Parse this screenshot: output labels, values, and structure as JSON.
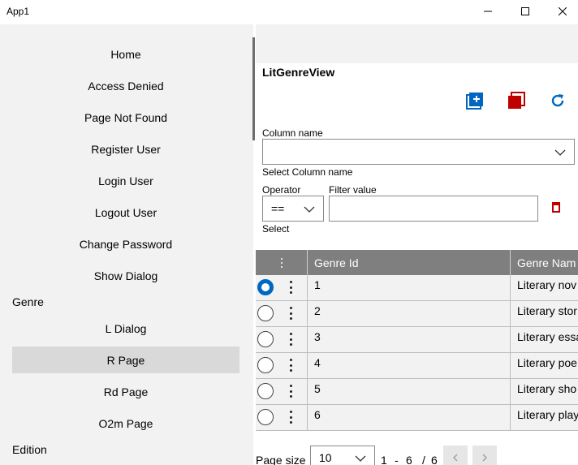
{
  "window": {
    "title": "App1"
  },
  "nav": {
    "items": [
      {
        "label": "Home"
      },
      {
        "label": "Access Denied"
      },
      {
        "label": "Page Not Found"
      },
      {
        "label": "Register User"
      },
      {
        "label": "Login User"
      },
      {
        "label": "Logout User"
      },
      {
        "label": "Change Password"
      },
      {
        "label": "Show Dialog"
      }
    ],
    "group_genre": "Genre",
    "genre_items": [
      {
        "label": "L Dialog"
      },
      {
        "label": "R Page",
        "selected": true
      },
      {
        "label": "Rd Page"
      },
      {
        "label": "O2m Page"
      }
    ],
    "group_edition": "Edition"
  },
  "view": {
    "title": "LitGenreView",
    "toolbar": {
      "icons": [
        "add-icon",
        "delete-icon",
        "refresh-icon"
      ],
      "colors": {
        "add": "#0067c0",
        "delete": "#c00000",
        "refresh": "#0067c0"
      }
    }
  },
  "filter": {
    "column_label": "Column name",
    "column_value": "",
    "column_helper": "Select Column name",
    "operator_label": "Operator",
    "operator_value": "==",
    "operator_helper": "Select",
    "filter_value_label": "Filter value",
    "filter_value": ""
  },
  "grid": {
    "columns": [
      "Genre Id",
      "Genre Nam"
    ],
    "rows": [
      {
        "id": "1",
        "name": "Literary nov",
        "selected": true
      },
      {
        "id": "2",
        "name": "Literary stor"
      },
      {
        "id": "3",
        "name": "Literary essa"
      },
      {
        "id": "4",
        "name": "Literary poe"
      },
      {
        "id": "5",
        "name": "Literary sho"
      },
      {
        "id": "6",
        "name": "Literary play"
      }
    ]
  },
  "pager": {
    "page_size_label": "Page size",
    "page_size": "10",
    "range_from": "1",
    "range_sep": "-",
    "range_to": "6",
    "total_sep": "/",
    "total": "6"
  }
}
